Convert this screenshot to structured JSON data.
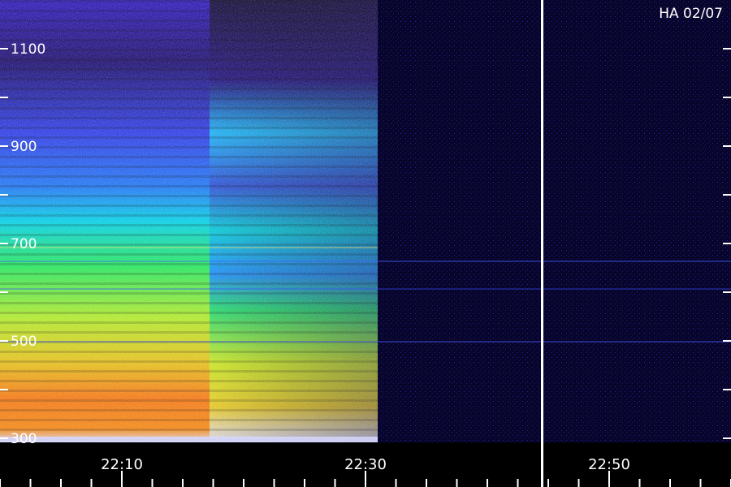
{
  "chart_data": {
    "type": "heatmap",
    "title": "HA 02/07",
    "y_ticks": [
      300,
      500,
      700,
      900,
      1100
    ],
    "y_minor_ticks": [
      400,
      600,
      800,
      1000
    ],
    "ylim": [
      293,
      1193
    ],
    "x_ticks": [
      "22:10",
      "22:30",
      "22:50"
    ],
    "x_tick_minutes": [
      10,
      30,
      50
    ],
    "xlim_minutes": [
      0,
      60
    ],
    "x_minor_tick_step_minutes": 2.5,
    "data_gap_from_minutes": 31.0,
    "separator_minute": 44.5,
    "segments": [
      {
        "name": "",
        "from_minutes": 0,
        "to_minutes": 17.2,
        "level_low_freq": 0.85,
        "level_high_freq": 0.25
      },
      {
        "name": "",
        "from_minutes": 17.2,
        "to_minutes": 31.0,
        "level_low_freq": 0.62,
        "level_high_freq": 0.18
      }
    ],
    "colors": {
      "background": "#000000",
      "axis": "#ffffff",
      "colormap": [
        "#0a0030",
        "#2a14c8",
        "#1f5cff",
        "#00d0ff",
        "#19f070",
        "#c8ff20",
        "#ffd000",
        "#ff6a00"
      ]
    }
  }
}
